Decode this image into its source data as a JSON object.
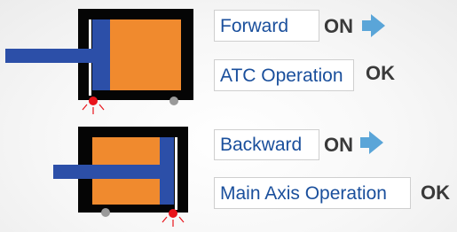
{
  "colors": {
    "cylinder_frame": "#050505",
    "piston_body": "#f08a2e",
    "rod": "#2c4fa8",
    "label_text": "#1a4f9c",
    "status_text": "#3a3a3a",
    "arrow": "#5aa5d8",
    "sensor_on": "#e8141b",
    "sensor_off": "#9a9a9a"
  },
  "top_cylinder": {
    "mode_label": "Forward",
    "mode_status": "ON",
    "operation_label": "ATC Operation",
    "operation_status": "OK",
    "arrow_icon": "right-arrow-icon"
  },
  "bottom_cylinder": {
    "mode_label": "Backward",
    "mode_status": "ON",
    "operation_label": "Main Axis Operation",
    "operation_status": "OK",
    "arrow_icon": "right-arrow-icon"
  }
}
